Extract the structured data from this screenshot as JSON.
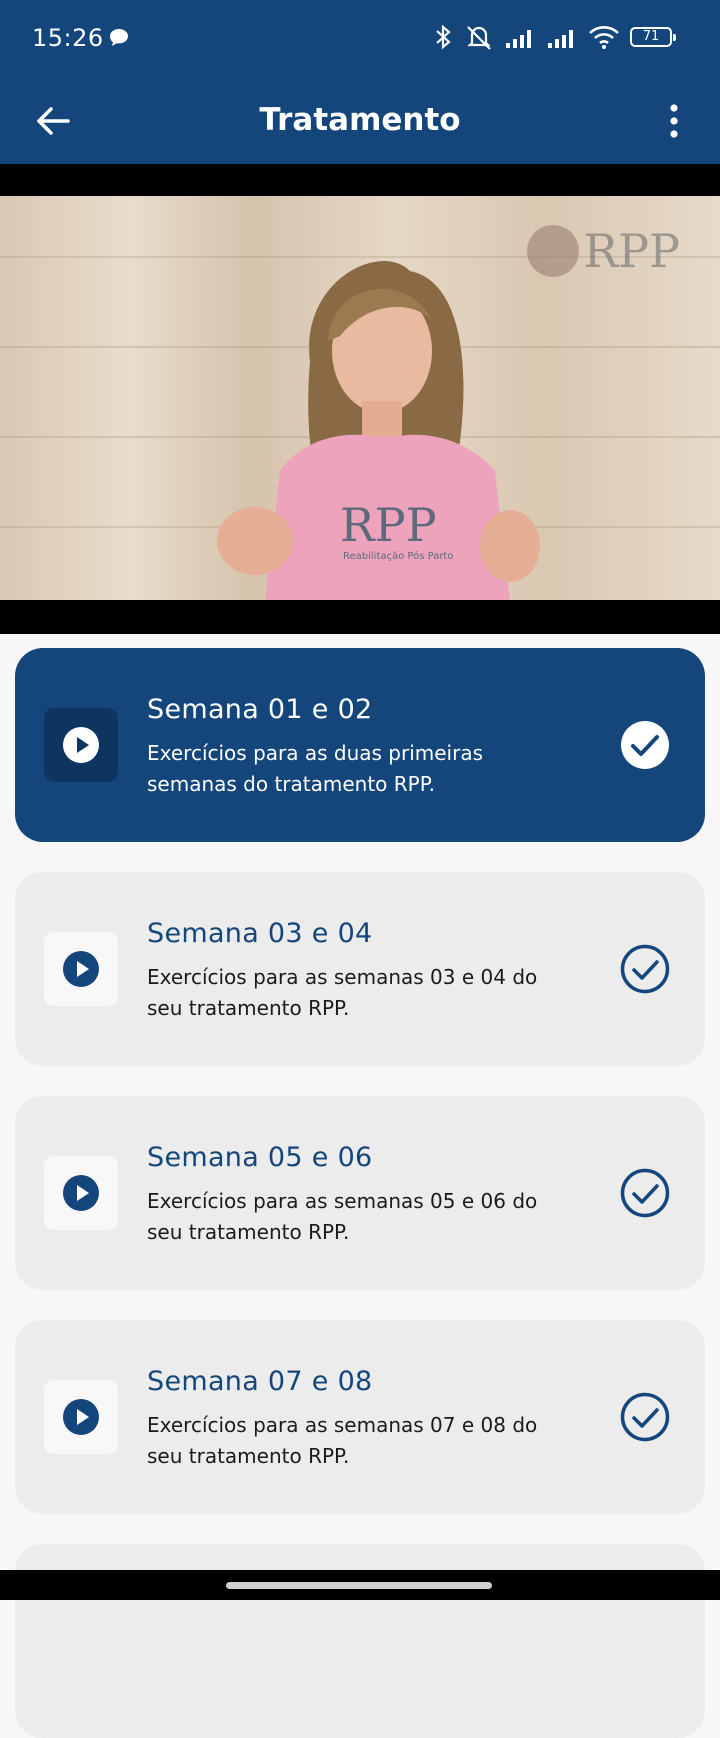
{
  "status_bar": {
    "time": "15:26",
    "battery": "71",
    "icons": [
      "message-icon",
      "bluetooth-icon",
      "mute-icon",
      "signal-icon",
      "signal-icon",
      "wifi-icon",
      "battery-icon"
    ]
  },
  "app_bar": {
    "title": "Tratamento",
    "back_icon": "arrow-left-icon",
    "menu_icon": "more-vertical-icon"
  },
  "video": {
    "logo_text": "RPP",
    "shirt_text": "RPP",
    "shirt_subtitle": "Reabilitação Pós Parto"
  },
  "weeks": [
    {
      "title": "Semana 01 e 02",
      "description": "Exercícios para as duas primeiras semanas do tratamento RPP.",
      "active": true,
      "completed": true
    },
    {
      "title": "Semana 03 e 04",
      "description": "Exercícios para as semanas 03 e 04 do seu tratamento RPP.",
      "active": false,
      "completed": true
    },
    {
      "title": "Semana 05 e 06",
      "description": "Exercícios para as semanas 05 e 06 do seu tratamento RPP.",
      "active": false,
      "completed": true
    },
    {
      "title": "Semana 07 e 08",
      "description": "Exercícios para as semanas 07 e 08 do seu tratamento RPP.",
      "active": false,
      "completed": true
    }
  ],
  "colors": {
    "primary": "#14467c",
    "card": "#ececec",
    "background": "#f7f7f7"
  }
}
